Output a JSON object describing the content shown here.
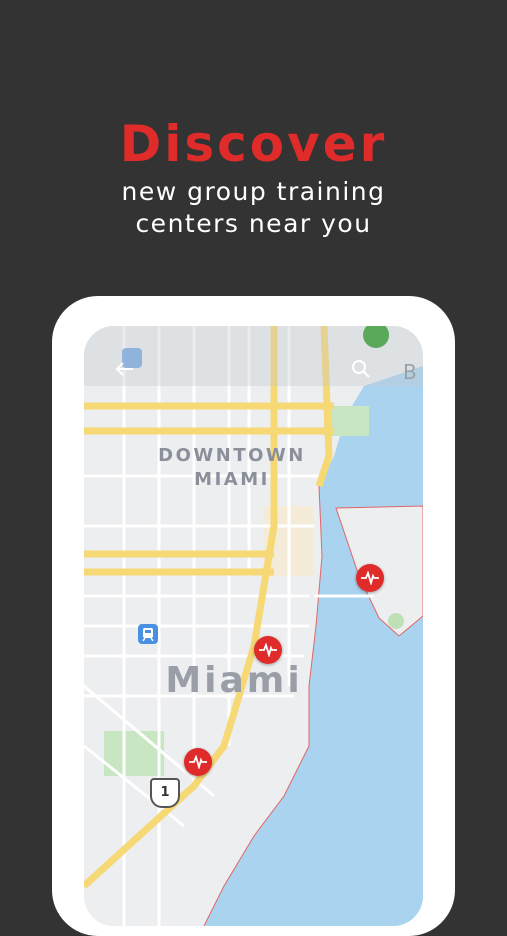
{
  "headline": {
    "title": "Discover",
    "subtitle_line1": "new group training",
    "subtitle_line2": "centers near you"
  },
  "map": {
    "labels": {
      "district_line1": "DOWNTOWN",
      "district_line2": "MIAMI",
      "city": "Miami",
      "partial": "B",
      "route_number": "1"
    },
    "pins": [
      {
        "name": "training-center-pin-1",
        "icon": "heartbeat-icon"
      },
      {
        "name": "training-center-pin-2",
        "icon": "heartbeat-icon"
      },
      {
        "name": "training-center-pin-3",
        "icon": "heartbeat-icon"
      }
    ],
    "colors": {
      "accent": "#e02b2b",
      "water": "#aad3f0",
      "land": "#eceef0",
      "highway": "#f6d874",
      "park": "#c8e6c2"
    }
  }
}
